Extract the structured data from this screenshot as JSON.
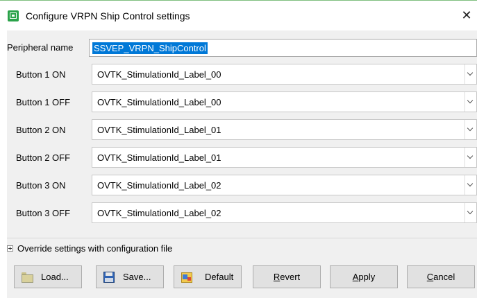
{
  "window": {
    "title": "Configure VRPN Ship Control settings",
    "close_glyph": "✕",
    "icon": "app-icon",
    "accent": "#2aa24a"
  },
  "form": {
    "peripheral_name_label": "Peripheral name",
    "peripheral_name_value": "SSVEP_VRPN_ShipControl",
    "rows": [
      {
        "label": "Button 1 ON",
        "value": "OVTK_StimulationId_Label_00"
      },
      {
        "label": "Button 1 OFF",
        "value": "OVTK_StimulationId_Label_00"
      },
      {
        "label": "Button 2 ON",
        "value": "OVTK_StimulationId_Label_01"
      },
      {
        "label": "Button 2 OFF",
        "value": "OVTK_StimulationId_Label_01"
      },
      {
        "label": "Button 3 ON",
        "value": "OVTK_StimulationId_Label_02"
      },
      {
        "label": "Button 3 OFF",
        "value": "OVTK_StimulationId_Label_02"
      }
    ]
  },
  "override": {
    "label": "Override settings with configuration file"
  },
  "buttons": {
    "load": "Load...",
    "save": "Save...",
    "default": "Default",
    "revert_first": "R",
    "revert_rest": "evert",
    "apply_first": "A",
    "apply_rest": "pply",
    "cancel_first": "C",
    "cancel_rest": "ancel"
  },
  "colors": {
    "selection": "#0078d7",
    "client_bg": "#f0f0f0"
  }
}
